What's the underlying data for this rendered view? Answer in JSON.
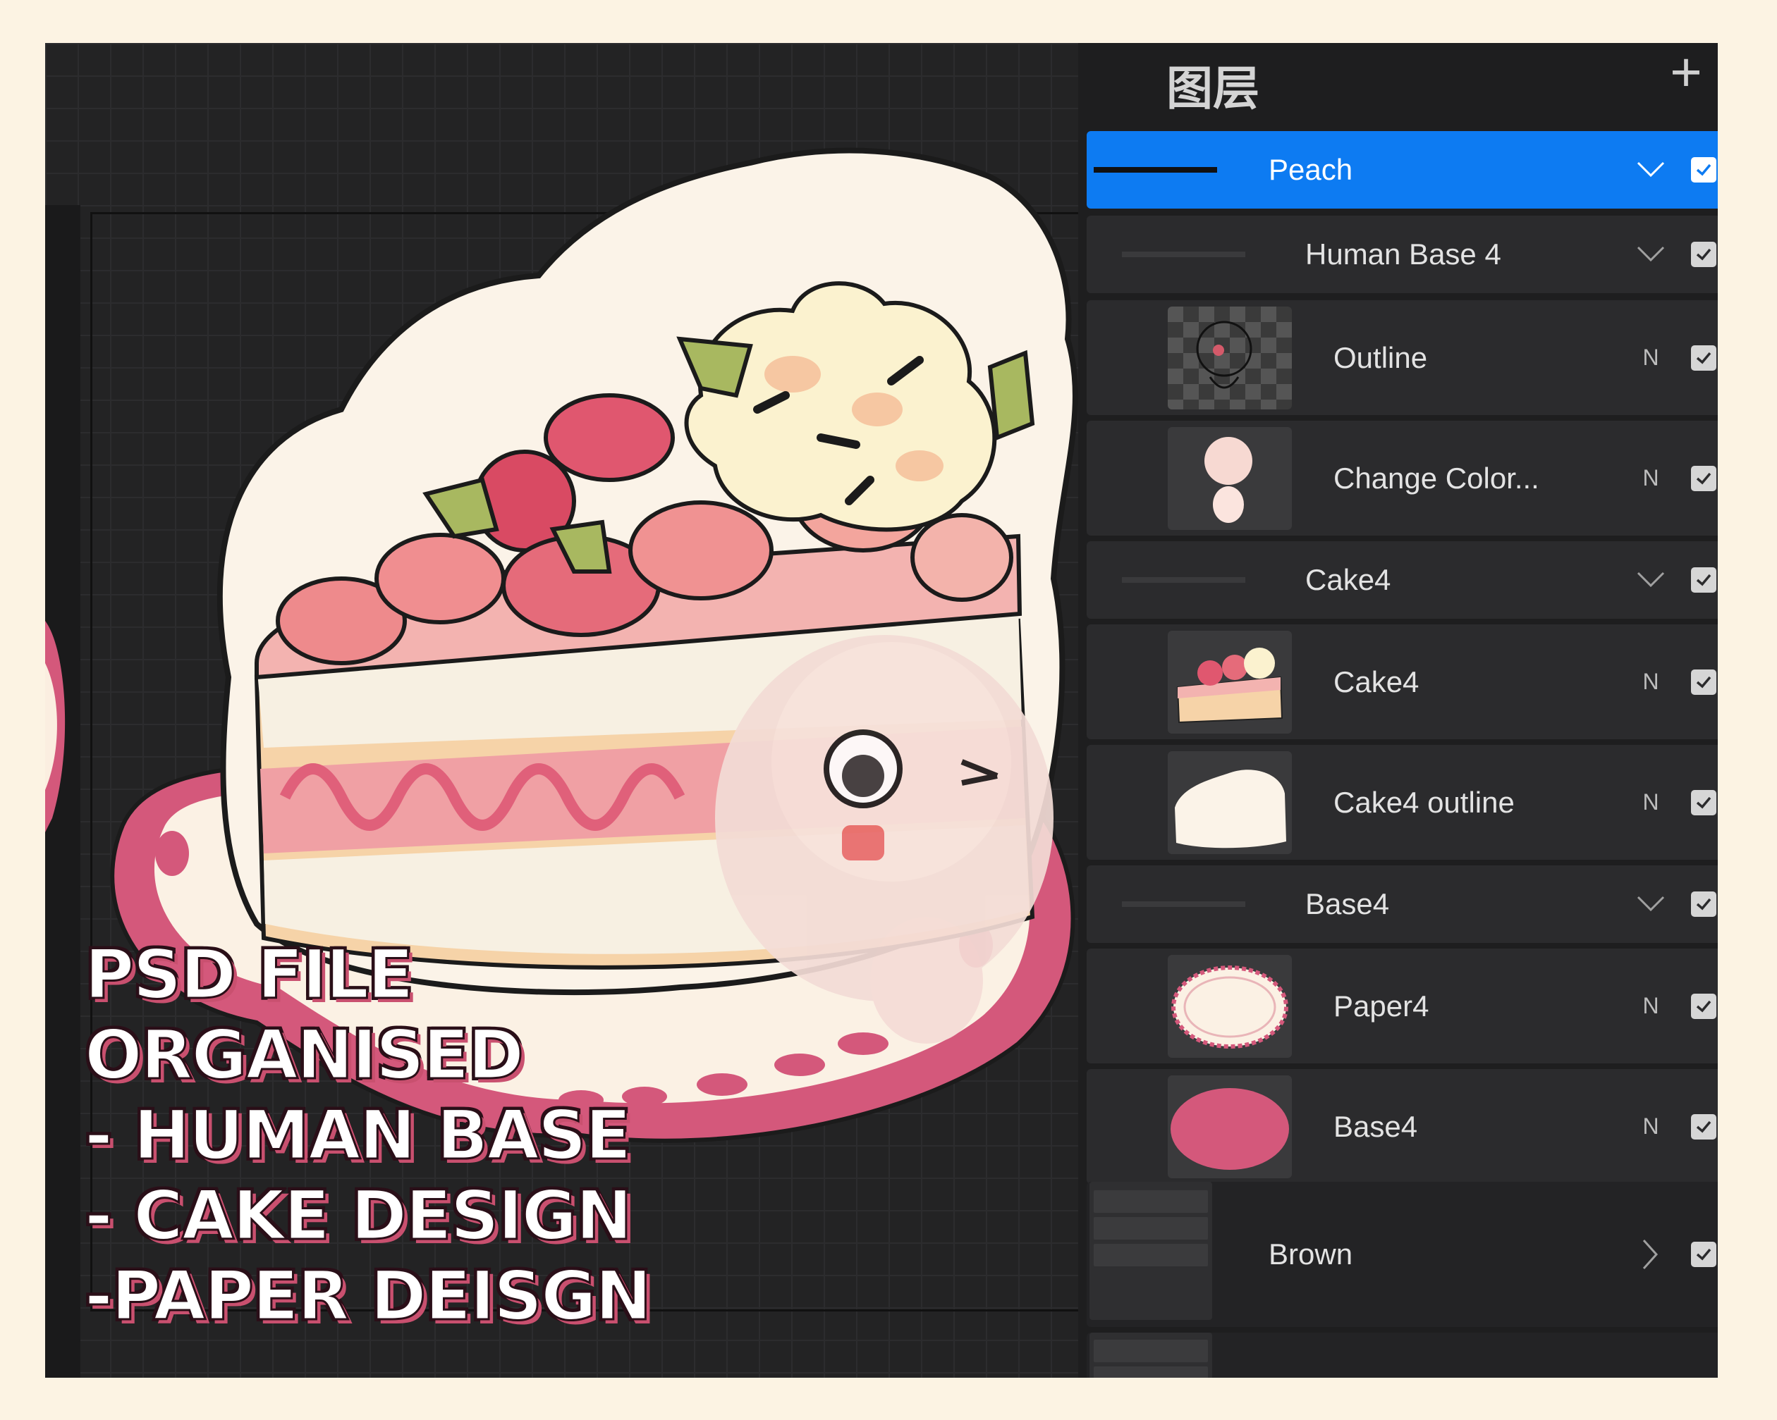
{
  "layers_panel": {
    "title": "图层",
    "add_label": "+",
    "layers": [
      {
        "name": "Peach",
        "kind": "group",
        "expanded": true,
        "selected": true,
        "visible": true
      },
      {
        "name": "Human Base 4",
        "kind": "group",
        "expanded": true,
        "visible": true
      },
      {
        "name": "Outline",
        "kind": "layer",
        "blend": "N",
        "visible": true
      },
      {
        "name": "Change Color...",
        "kind": "layer",
        "blend": "N",
        "visible": true
      },
      {
        "name": "Cake4",
        "kind": "group",
        "expanded": true,
        "visible": true
      },
      {
        "name": "Cake4",
        "kind": "layer",
        "blend": "N",
        "visible": true
      },
      {
        "name": "Cake4 outline",
        "kind": "layer",
        "blend": "N",
        "visible": true
      },
      {
        "name": "Base4",
        "kind": "group",
        "expanded": true,
        "visible": true
      },
      {
        "name": "Paper4",
        "kind": "layer",
        "blend": "N",
        "visible": true
      },
      {
        "name": "Base4",
        "kind": "layer",
        "blend": "N",
        "visible": true
      },
      {
        "name": "Brown",
        "kind": "group",
        "expanded": false,
        "visible": true
      }
    ]
  },
  "promo": {
    "lines": [
      "PSD FILE",
      "ORGANISED",
      "- HUMAN BASE",
      "- CAKE DESIGN",
      "-PAPER DEISGN"
    ]
  },
  "colors": {
    "page_background": "#fcf3e3",
    "accent": "#0d7bf2",
    "panel_background": "#1e1e1f",
    "canvas_background": "#232324"
  },
  "icons": {
    "add": "plus-icon",
    "expand": "chevron-down-icon",
    "collapsed": "chevron-right-icon",
    "visibility": "checkbox-checked-icon"
  }
}
